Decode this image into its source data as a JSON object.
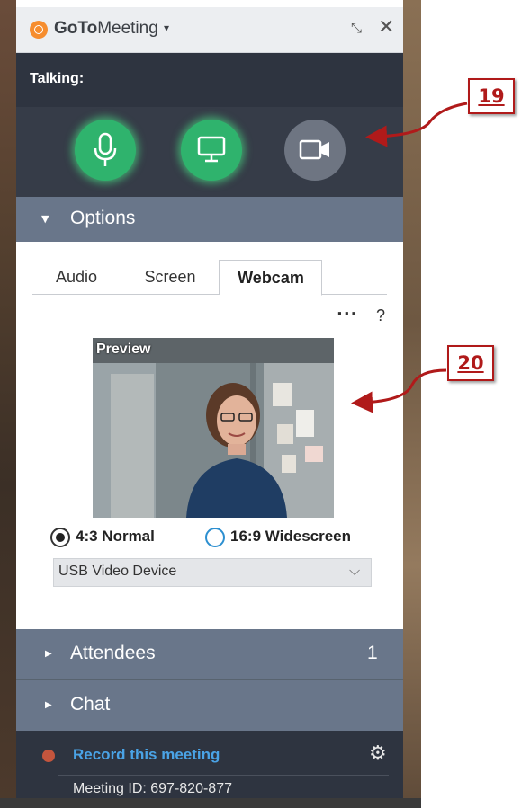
{
  "window": {
    "brand_bold": "GoTo",
    "brand_light": "Meeting",
    "brand_caret": "▾",
    "minimize_icon": "⤡",
    "close_icon": "✕"
  },
  "talking": {
    "label": "Talking:"
  },
  "controls": {
    "microphone": {
      "icon": "microphone-icon",
      "state": "on",
      "color": "#2fb36d"
    },
    "screen_share": {
      "icon": "monitor-icon",
      "state": "on",
      "color": "#2fb36d"
    },
    "webcam": {
      "icon": "video-camera-icon",
      "state": "off",
      "color": "#6e7582"
    }
  },
  "options": {
    "label": "Options",
    "expand_icon": "▼",
    "tabs": [
      {
        "label": "Audio",
        "active": false
      },
      {
        "label": "Screen",
        "active": false
      },
      {
        "label": "Webcam",
        "active": true
      }
    ],
    "more_label": "···",
    "help_label": "?",
    "preview_label": "Preview",
    "aspect_ratio": {
      "normal_label": "4:3 Normal",
      "widescreen_label": "16:9 Widescreen",
      "selected": "4:3 Normal"
    },
    "device": {
      "value": "USB Video Device",
      "chevron": "⌵"
    }
  },
  "attendees": {
    "label": "Attendees",
    "count": "1",
    "expand_icon": "▶"
  },
  "chat": {
    "label": "Chat",
    "expand_icon": "▶"
  },
  "footer": {
    "record_label": "Record this meeting",
    "settings_icon": "⚙",
    "meeting_id": "Meeting ID: 697-820-877"
  },
  "callouts": [
    {
      "label": "19"
    },
    {
      "label": "20"
    }
  ],
  "colors": {
    "accent_green": "#2fb36d",
    "header_slate": "#69768a",
    "dark_bar": "#2e3440",
    "link_blue": "#4aa3e6",
    "callout_red": "#b01a1a"
  }
}
